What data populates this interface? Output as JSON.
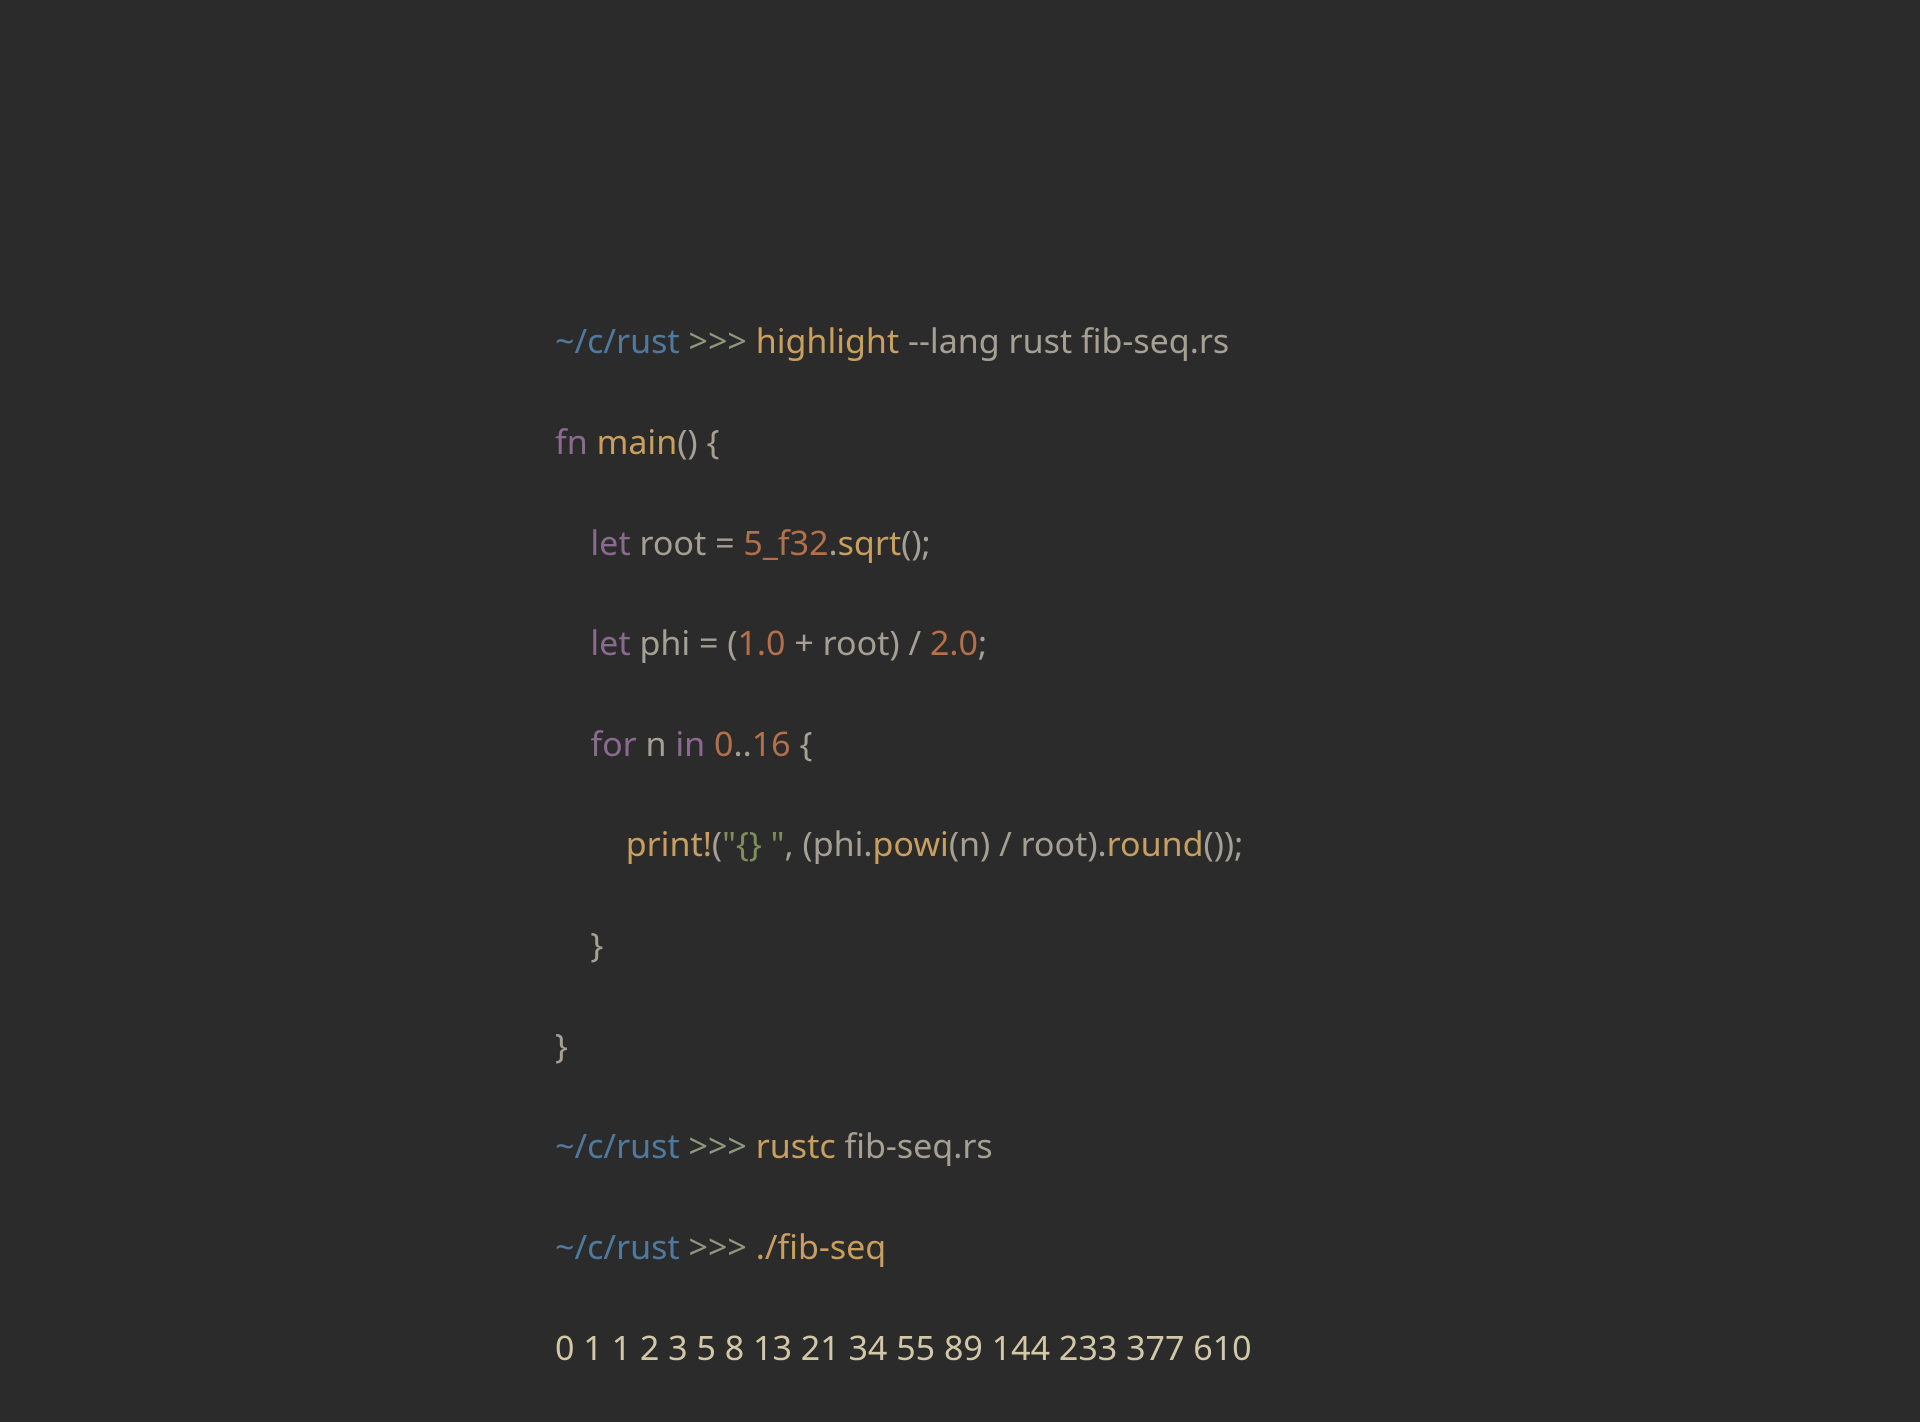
{
  "prompt": {
    "path": "~/c/rust",
    "marker": ">>>"
  },
  "cmd1": {
    "bin": "highlight",
    "flag": "--lang",
    "lang": "rust",
    "file": "fib-seq.rs"
  },
  "code": {
    "fn": "fn",
    "main": "main",
    "lpar": "()",
    "lbrace": " {",
    "let1": "let",
    "root": "root",
    "eq": " = ",
    "five": "5_f32",
    "dot1": ".",
    "sqrt": "sqrt",
    "call1": "();",
    "let2": "let",
    "phi": "phi",
    "eq2": " = (",
    "one": "1.0",
    "plus": " + ",
    "rootv": "root",
    "rpar_div": ") / ",
    "two": "2.0",
    "semi2": ";",
    "for": "for",
    "n": " n ",
    "in": "in",
    "range_sp": " ",
    "zero": "0",
    "dots": "..",
    "sixteen": "16",
    "lbrace2": " {",
    "print": "print!",
    "lpar2": "(",
    "fmt": "\"{} \"",
    "comma": ", (",
    "phiv": "phi",
    "dot2": ".",
    "powi": "powi",
    "lpar3": "(",
    "nv": "n",
    "rpar3": ") / ",
    "rootv2": "root",
    "rpar4": ").",
    "round": "round",
    "call2": "());",
    "rbrace_inner": "}",
    "rbrace_outer": "}"
  },
  "cmd2": {
    "bin": "rustc",
    "file": "fib-seq.rs"
  },
  "cmd3": {
    "run": "./fib-seq"
  },
  "output": "0 1 1 2 3 5 8 13 21 34 55 89 144 233 377 610"
}
